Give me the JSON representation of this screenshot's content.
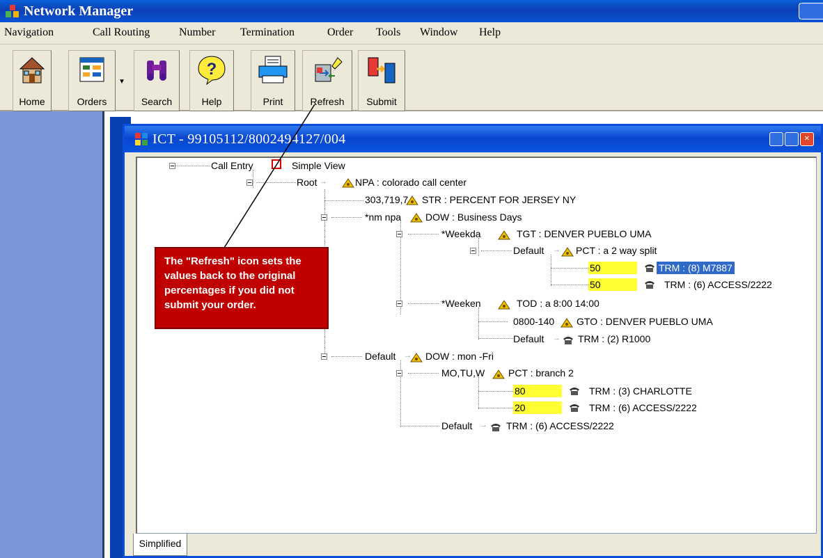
{
  "app": {
    "title": "Network Manager"
  },
  "menu": [
    "Navigation",
    "Call Routing",
    "Number",
    "Termination",
    "Order",
    "Tools",
    "Window",
    "Help"
  ],
  "toolbar": {
    "home": "Home",
    "orders": "Orders",
    "search": "Search",
    "help": "Help",
    "print": "Print",
    "refresh": "Refresh",
    "submit": "Submit"
  },
  "window": {
    "title": "ICT - 99105112/8002494127/004"
  },
  "tab": {
    "label": "Simplified"
  },
  "tree": {
    "call_entry": "Call Entry",
    "simple_view": "Simple View",
    "root": "Root",
    "npa": "NPA : colorado call center",
    "str_key": "303,719,7",
    "str": "STR : PERCENT FOR JERSEY NY",
    "nm_npa": "*nm npa",
    "dow1": "DOW : Business Days",
    "weekday": "*Weekda",
    "tgt": "TGT : DENVER PUEBLO UMA",
    "default1": "Default",
    "pct1": "PCT : a 2 way split",
    "pct1_v1": "50",
    "trm1": "TRM : (8) M7887",
    "pct1_v2": "50",
    "trm2": "TRM : (6) ACCESS/2222",
    "weekend": "*Weeken",
    "tod": "TOD : a 8:00 14:00",
    "gto_key": "0800-140",
    "gto": "GTO : DENVER PUEBLO UMA",
    "default2": "Default",
    "trm3": "TRM : (2) R1000",
    "default3": "Default",
    "dow2": "DOW : mon -Fri",
    "motuw": "MO,TU,W",
    "pct2": "PCT : branch 2",
    "pct2_v1": "80",
    "trm4": "TRM : (3) CHARLOTTE",
    "pct2_v2": "20",
    "trm5": "TRM : (6) ACCESS/2222",
    "default4": "Default",
    "trm6": "TRM : (6) ACCESS/2222"
  },
  "callout": {
    "text": "The \"Refresh\" icon sets the values back to the original percentages if you did not submit your order."
  },
  "colors": {
    "callout": "#c00000",
    "highlight_yellow": "#ffff33",
    "selection_blue": "#2f6ac9",
    "title_blue": "#0a54d4"
  }
}
